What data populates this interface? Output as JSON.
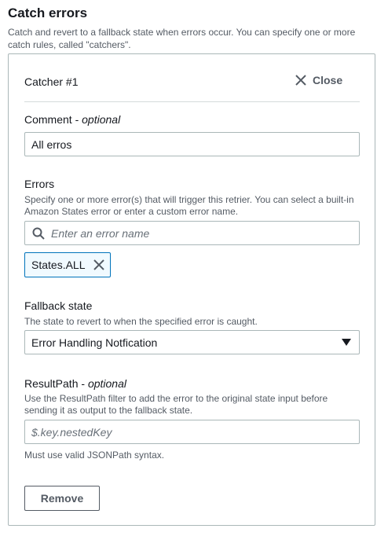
{
  "section": {
    "title": "Catch errors",
    "description": "Catch and revert to a fallback state when errors occur. You can specify one or more catch rules, called \"catchers\"."
  },
  "catcher": {
    "title": "Catcher #1",
    "close_label": "Close",
    "close_icon": "x-icon"
  },
  "comment": {
    "label": "Comment",
    "optional": "optional",
    "separator": " - ",
    "value": "All erros"
  },
  "errors": {
    "label": "Errors",
    "help": "Specify one or more error(s) that will trigger this retrier. You can select a built-in Amazon States error or enter a custom error name.",
    "placeholder": "Enter an error name",
    "search_icon": "search-icon",
    "tokens": [
      {
        "label": "States.ALL",
        "remove_icon": "x-icon"
      }
    ]
  },
  "fallback": {
    "label": "Fallback state",
    "help": "The state to revert to when the specified error is caught.",
    "selected": "Error Handling Notfication",
    "caret_icon": "caret-down-icon"
  },
  "result_path": {
    "label": "ResultPath",
    "optional": "optional",
    "separator": " - ",
    "help": "Use the ResultPath filter to add the error to the original state input before sending it as output to the fallback state.",
    "placeholder": "$.key.nestedKey",
    "hint": "Must use valid JSONPath syntax."
  },
  "remove_label": "Remove",
  "colors": {
    "border": "#aab7b8",
    "token_border": "#0073bb",
    "token_bg": "#f1faff",
    "text": "#16191f",
    "muted": "#545b64"
  }
}
